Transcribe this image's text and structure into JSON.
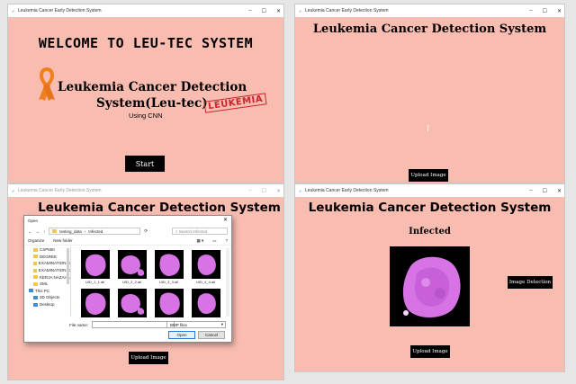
{
  "win1": {
    "title": "Leukemia Cancer Early Detection System",
    "welcome": "WELCOME TO LEU-TEC SYSTEM",
    "logo_line1": "Leukemia Cancer Detection",
    "logo_line2": "System(Leu-tec)",
    "stamp": "LEUKEMIA",
    "using": "Using CNN",
    "start_label": "Start"
  },
  "win2": {
    "title": "Leukemia Cancer Early Detection System",
    "heading": "Leukemia Cancer Detection System",
    "upload_label": "Upload Image"
  },
  "win3": {
    "title": "Leukemia Cancer Early Detection System",
    "heading": "Leukemia Cancer Detection System",
    "upload_label": "Upload Image"
  },
  "win4": {
    "title": "Leukemia Cancer Early Detection System",
    "heading": "Leukemia Cancer Detection System",
    "result": "Infected",
    "detect_label": "Image Detection",
    "upload_label": "Upload Image"
  },
  "dialog": {
    "title": "Open",
    "path": [
      "testing_data",
      "Infected"
    ],
    "search_placeholder": "Search Infected",
    "organize": "Organize",
    "new_folder": "New folder",
    "nav_items": [
      {
        "label": "CSP650",
        "kind": "folder"
      },
      {
        "label": "DEGREE",
        "kind": "folder"
      },
      {
        "label": "EXAMINATION R",
        "kind": "folder"
      },
      {
        "label": "EXAMINATION R",
        "kind": "folder"
      },
      {
        "label": "KERJA NAZAHA",
        "kind": "folder"
      },
      {
        "label": "SML",
        "kind": "folder"
      },
      {
        "label": "This PC",
        "kind": "pc"
      },
      {
        "label": "3D Objects",
        "kind": "pc"
      },
      {
        "label": "Desktop",
        "kind": "pc"
      }
    ],
    "files": [
      "UID_1_1.all",
      "UID_2_2.all",
      "UID_3_3.all",
      "UID_4_4.all",
      "",
      "",
      "",
      ""
    ],
    "file_name_label": "File name:",
    "file_type": "BMP files",
    "open_label": "Open",
    "cancel_label": "Cancel"
  },
  "colors": {
    "background": "#f9bcb1",
    "ribbon": "#f07f1c",
    "cell": "#d873e6",
    "stamp": "#c8242b"
  }
}
